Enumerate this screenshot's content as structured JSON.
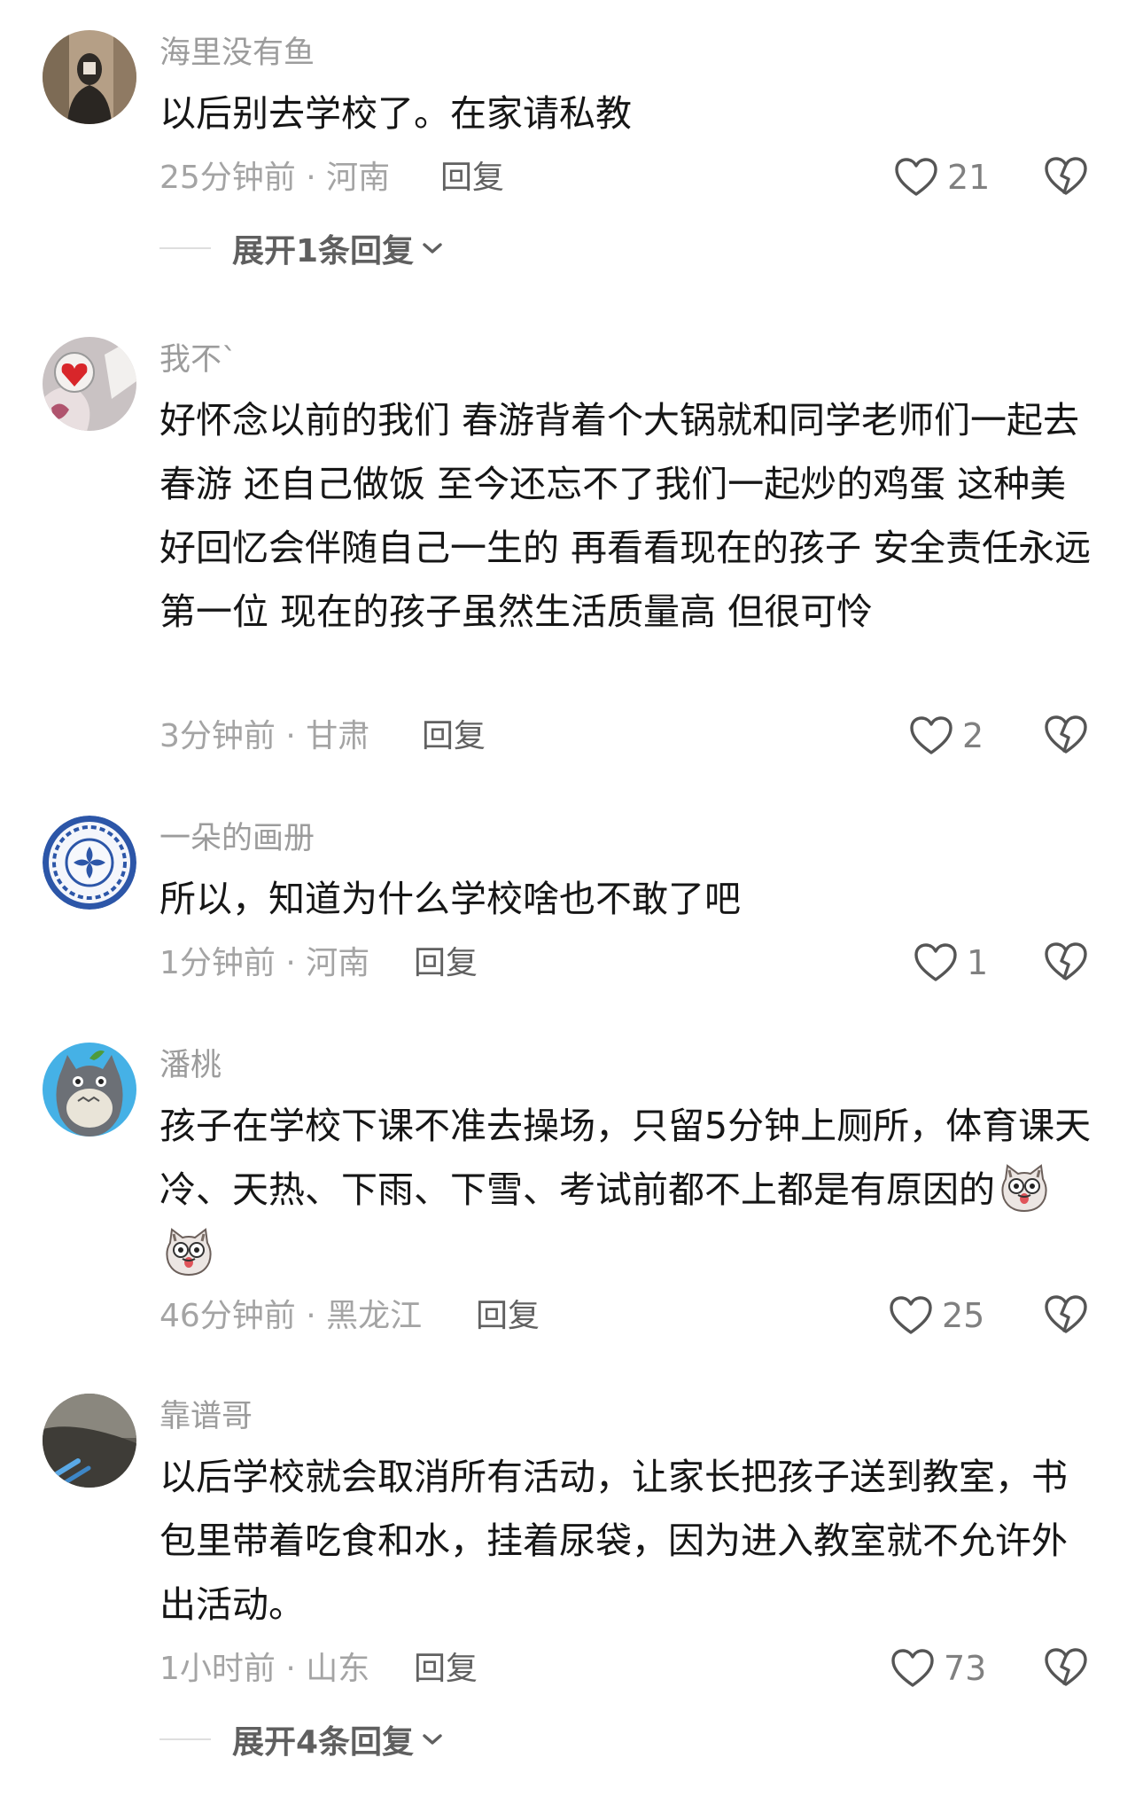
{
  "comments": [
    {
      "username": "海里没有鱼",
      "text": "以后别去学校了。在家请私教",
      "meta": "25分钟前 · 河南",
      "reply": "回复",
      "likes": "21",
      "expand": "展开1条回复"
    },
    {
      "username": "我不`",
      "text": "好怀念以前的我们 春游背着个大锅就和同学老师们一起去春游 还自己做饭 至今还忘不了我们一起炒的鸡蛋 这种美好回忆会伴随自己一生的 再看看现在的孩子 安全责任永远第一位 现在的孩子虽然生活质量高 但很可怜",
      "meta": "3分钟前 · 甘肃",
      "reply": "回复",
      "likes": "2"
    },
    {
      "username": "一朵的画册",
      "text": "所以，知道为什么学校啥也不敢了吧",
      "meta": "1分钟前 · 河南",
      "reply": "回复",
      "likes": "1"
    },
    {
      "username": "潘桃",
      "text": "孩子在学校下课不准去操场，只留5分钟上厕所，体育课天冷、天热、下雨、下雪、考试前都不上都是有原因的",
      "emojis": [
        "cat-face-emoji",
        "cat-face-emoji"
      ],
      "meta": "46分钟前 · 黑龙江",
      "reply": "回复",
      "likes": "25"
    },
    {
      "username": "靠谱哥",
      "text": "以后学校就会取消所有活动，让家长把孩子送到教室，书包里带着吃食和水，挂着尿袋，因为进入教室就不允许外出活动。",
      "meta": "1小时前 · 山东",
      "reply": "回复",
      "likes": "73",
      "expand": "展开4条回复"
    }
  ],
  "icons": {
    "like": "heart-outline-icon",
    "dislike": "broken-heart-icon",
    "expand": "chevron-down-icon"
  },
  "colors": {
    "text": "#161616",
    "username": "#9c9c9c",
    "meta": "#a4a4a4",
    "reply": "#616161",
    "icon": "#555555"
  }
}
